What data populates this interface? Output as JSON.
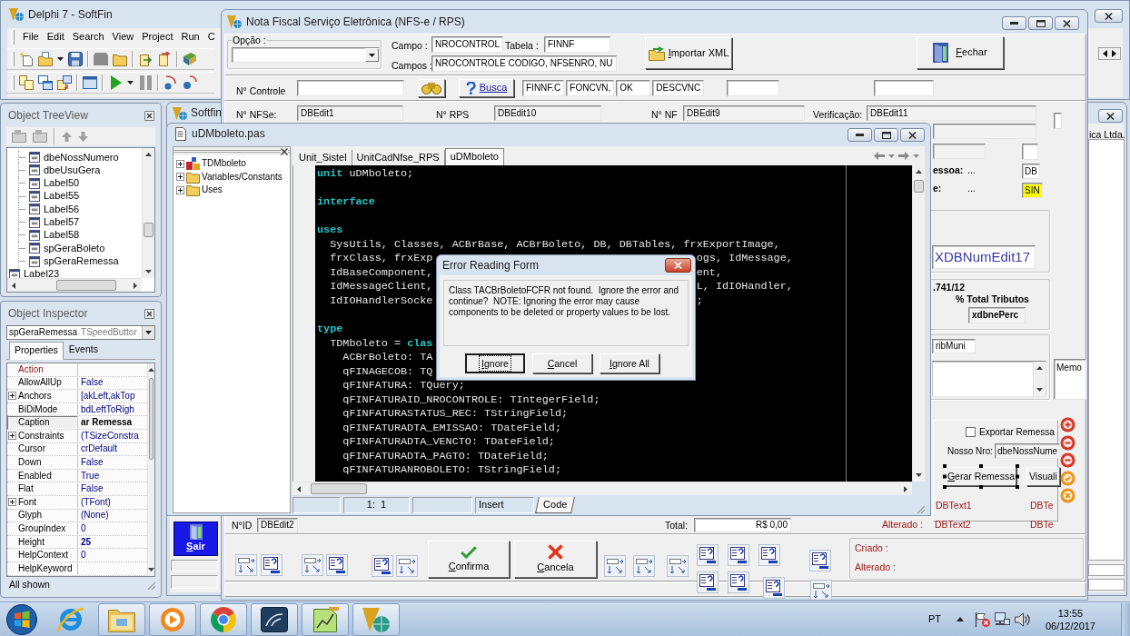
{
  "ide": {
    "title": "Delphi 7 - SoftFin",
    "menu": [
      "File",
      "Edit",
      "Search",
      "View",
      "Project",
      "Run",
      "C"
    ]
  },
  "object_treeview": {
    "title": "Object TreeView",
    "tree": [
      {
        "children": [
          {
            "label": "dbeNossNumero"
          },
          {
            "label": "dbeUsuGera"
          },
          {
            "label": "Label50"
          },
          {
            "label": "Label55"
          },
          {
            "label": "Label56"
          },
          {
            "label": "Label57"
          },
          {
            "label": "Label58"
          },
          {
            "label": "spGeraBoleto"
          },
          {
            "label": "spGeraRemessa"
          }
        ]
      },
      {
        "label": "Label23"
      }
    ]
  },
  "object_inspector": {
    "title": "Object Inspector",
    "component": "spGeraRemessa",
    "component_type": "TSpeedButtor",
    "tabs": [
      {
        "label": "Properties",
        "selected": true
      },
      {
        "label": "Events",
        "selected": false
      }
    ],
    "properties": [
      {
        "name": "Action",
        "kind": "reference",
        "expandable": false,
        "modified": false,
        "selected": false
      },
      {
        "name": "AllowAllUp",
        "value": "False",
        "kind": "property",
        "expandable": false,
        "modified": false,
        "selected": false
      },
      {
        "name": "Anchors",
        "value": "[akLeft,akTop",
        "kind": "property",
        "expandable": true,
        "modified": false,
        "selected": false
      },
      {
        "name": "BiDiMode",
        "value": "bdLeftToRigh",
        "kind": "property",
        "expandable": false,
        "modified": false,
        "selected": false
      },
      {
        "name": "Caption",
        "value": "ar Remessa",
        "kind": "property",
        "expandable": false,
        "modified": true,
        "selected": true
      },
      {
        "name": "Constraints",
        "value": "(TSizeConstra",
        "kind": "property",
        "expandable": true,
        "modified": false,
        "selected": false
      },
      {
        "name": "Cursor",
        "value": "crDefault",
        "kind": "property",
        "expandable": false,
        "modified": false,
        "selected": false
      },
      {
        "name": "Down",
        "value": "False",
        "kind": "property",
        "expandable": false,
        "modified": false,
        "selected": false
      },
      {
        "name": "Enabled",
        "value": "True",
        "kind": "property",
        "expandable": false,
        "modified": false,
        "selected": false
      },
      {
        "name": "Flat",
        "value": "False",
        "kind": "property",
        "expandable": false,
        "modified": false,
        "selected": false
      },
      {
        "name": "Font",
        "value": "(TFont)",
        "kind": "property",
        "expandable": true,
        "modified": false,
        "selected": false
      },
      {
        "name": "Glyph",
        "value": "(None)",
        "kind": "property",
        "expandable": false,
        "modified": false,
        "selected": false
      },
      {
        "name": "GroupIndex",
        "value": "0",
        "kind": "property",
        "expandable": false,
        "modified": false,
        "selected": false
      },
      {
        "name": "Height",
        "value": "25",
        "kind": "property",
        "expandable": false,
        "modified": true,
        "selected": false
      },
      {
        "name": "HelpContext",
        "value": "0",
        "kind": "property",
        "expandable": false,
        "modified": false,
        "selected": false
      },
      {
        "name": "HelpKeyword",
        "kind": "property",
        "expandable": false,
        "modified": false,
        "selected": false
      }
    ],
    "status": "All shown"
  },
  "softfin_window": {
    "title": "Softfin",
    "company": "ica Ltda.",
    "exit_button": "Sair"
  },
  "nfse_form": {
    "title": "Nota Fiscal Serviço Eletrônica (NFS-e / RPS)",
    "option_label": "Opção :",
    "campo_label": "Campo :",
    "campo_value": "NROCONTROL",
    "tabela_label": "Tabela :",
    "tabela_value": "FINNF",
    "campos_label": "Campos :",
    "campos_value": "NROCONTROLE CODIGO, NFSENRO, NU",
    "import_button": "Importar XML",
    "close_button": "Fechar",
    "controle_label": "N° Controle",
    "search_button": "Busca",
    "search_values": [
      "FINNF.C",
      "FONCVN,",
      "OK",
      "DESCVNC"
    ],
    "nfse_label": "N° NFSe:",
    "nfse_value": "DBEdit1",
    "rps_label": "N° RPS",
    "rps_value": "DBEdit10",
    "nf_label": "N° NF",
    "nf_value": "DBEdit9",
    "verificacao_label": "Verificação:",
    "verificacao_value": "DBEdit11",
    "pessoa_label": "essoa:",
    "pessoa_info": "...",
    "pessoa_value": "DB",
    "e_label": "e:",
    "e_info": "...",
    "e_value": "SIN",
    "num_edit_value": "XDBNumEdit17",
    "fraction_text": ".741/12",
    "total_tributos_label": "% Total Tributos",
    "perc_value": "xdbnePerc",
    "trib_value": "ribMuni",
    "memo_value": "Memo",
    "export_checkbox": {
      "label": "Exportar Remessa",
      "checked": false
    },
    "nosso_label": "Nosso Nro:",
    "nosso_value": "dbeNossNume",
    "generate_button": {
      "label": "Gerar Remessa",
      "selected": true
    },
    "view_button": "Visuali",
    "created_text": "DBText1",
    "created_text_2": "DBTe",
    "altered_label": "Alterado :",
    "altered_text": "DBText2",
    "altered_text_2": "DBTe",
    "id_label": "N°ID",
    "id_value": "DBEdit2",
    "total_label": "Total:",
    "total_value": "R$ 0,00",
    "confirm_button": "Confirma",
    "cancel_button": "Cancela",
    "audit_labels": [
      "Criado :",
      "Alterado :"
    ]
  },
  "code_editor": {
    "title": "uDMboleto.pas",
    "explorer": [
      {
        "label": "TDMboleto",
        "kind": "class"
      },
      {
        "label": "Variables/Constants",
        "kind": "folder"
      },
      {
        "label": "Uses",
        "kind": "folder"
      }
    ],
    "tabs": [
      {
        "label": "Unit_Sistel",
        "selected": false
      },
      {
        "label": "UnitCadNfse_RPS",
        "selected": false
      },
      {
        "label": "uDMboleto",
        "selected": true
      }
    ],
    "lines": [
      {
        "kind": "code",
        "text": "**unit** uDMboleto;"
      },
      {
        "kind": "blank"
      },
      {
        "kind": "keyword",
        "text": "interface"
      },
      {
        "kind": "blank"
      },
      {
        "kind": "keyword",
        "text": "uses"
      },
      {
        "kind": "code",
        "text": "  SysUtils, Classes, ACBrBase, ACBrBoleto, DB, DBTables, frxExportImage,"
      },
      {
        "kind": "code",
        "text": "  frxClass, frxExp",
        "tail": "ogs, IdMessage,"
      },
      {
        "kind": "code",
        "text": "  IdBaseComponent,",
        "tail": "ent,"
      },
      {
        "kind": "code",
        "text": "  IdMessageClient,",
        "tail": "L, IdIOHandler,"
      },
      {
        "kind": "code",
        "text": "  IdIOHandlerSocke",
        "tail": ";"
      },
      {
        "kind": "blank"
      },
      {
        "kind": "keyword",
        "text": "type"
      },
      {
        "kind": "code",
        "text": "  TDMboleto = **clas**"
      },
      {
        "kind": "code",
        "text": "    ACBrBoleto: TA"
      },
      {
        "kind": "code",
        "text": "    qFINAGECOB: TQ"
      },
      {
        "kind": "code",
        "text": "    qFINFATURA: TQuery;"
      },
      {
        "kind": "code",
        "text": "    qFINFATURAID_NROCONTROLE: TIntegerField;"
      },
      {
        "kind": "code",
        "text": "    qFINFATURASTATUS_REC: TStringField;"
      },
      {
        "kind": "code",
        "text": "    qFINFATURADTA_EMISSAO: TDateField;"
      },
      {
        "kind": "code",
        "text": "    qFINFATURADTA_VENCTO: TDateField;"
      },
      {
        "kind": "code",
        "text": "    qFINFATURADTA_PAGTO: TDateField;"
      },
      {
        "kind": "code",
        "text": "    qFINFATURANROBOLETO: TStringField;"
      }
    ],
    "cursor_position": "1:  1",
    "mode": "Insert",
    "view_tab": "Code"
  },
  "error_dialog": {
    "title": "Error Reading Form",
    "message": "Class TACBrBoletoFCFR not found.  Ignore the error and continue?  NOTE: Ignoring the error may cause components to be deleted or property values to be lost.",
    "buttons": [
      {
        "label": "Ignore",
        "focused": true
      },
      {
        "label": "Cancel",
        "focused": false
      },
      {
        "label": "Ignore All",
        "focused": false
      }
    ]
  },
  "taskbar": {
    "apps": [
      {
        "running": false
      },
      {
        "running": true
      },
      {
        "running": true
      },
      {
        "running": true
      },
      {
        "running": true
      },
      {
        "running": true
      },
      {
        "running": true
      }
    ],
    "language": "PT",
    "time": "13:55",
    "date": "06/12/2017"
  }
}
